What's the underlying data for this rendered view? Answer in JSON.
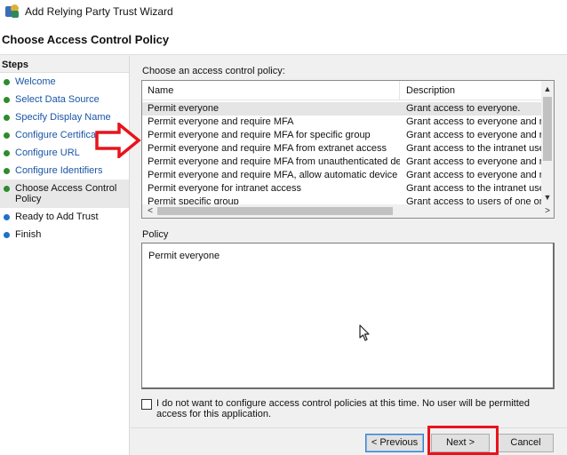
{
  "window": {
    "title": "Add Relying Party Trust Wizard",
    "icon": "relying-party-wizard-icon"
  },
  "header": {
    "page_title": "Choose Access Control Policy"
  },
  "steps": {
    "title": "Steps",
    "items": [
      {
        "label": "Welcome",
        "status": "completed"
      },
      {
        "label": "Select Data Source",
        "status": "completed"
      },
      {
        "label": "Specify Display Name",
        "status": "completed"
      },
      {
        "label": "Configure Certificate",
        "status": "completed"
      },
      {
        "label": "Configure URL",
        "status": "completed"
      },
      {
        "label": "Configure Identifiers",
        "status": "completed"
      },
      {
        "label": "Choose Access Control Policy",
        "status": "current"
      },
      {
        "label": "Ready to Add Trust",
        "status": "pending"
      },
      {
        "label": "Finish",
        "status": "pending"
      }
    ],
    "colors": {
      "completed": "#2e8b2e",
      "pending": "#1f6fd0",
      "link": "#1a55a6"
    }
  },
  "policy_list": {
    "caption": "Choose an access control policy:",
    "columns": [
      "Name",
      "Description"
    ],
    "selected_index": 0,
    "rows": [
      {
        "name": "Permit everyone",
        "description": "Grant access to everyone."
      },
      {
        "name": "Permit everyone and require MFA",
        "description": "Grant access to everyone and requir"
      },
      {
        "name": "Permit everyone and require MFA for specific group",
        "description": "Grant access to everyone and requir"
      },
      {
        "name": "Permit everyone and require MFA from extranet access",
        "description": "Grant access to the intranet users an"
      },
      {
        "name": "Permit everyone and require MFA from unauthenticated devices",
        "description": "Grant access to everyone and requir"
      },
      {
        "name": "Permit everyone and require MFA, allow automatic device registr...",
        "description": "Grant access to everyone and requir"
      },
      {
        "name": "Permit everyone for intranet access",
        "description": "Grant access to the intranet users."
      },
      {
        "name": "Permit specific group",
        "description": "Grant access to users of one or more"
      }
    ],
    "scroll_icons": {
      "up": "▲",
      "down": "▼",
      "left": "<",
      "right": ">"
    }
  },
  "policy_detail": {
    "caption": "Policy",
    "text": "Permit everyone"
  },
  "opt_out": {
    "checked": false,
    "label": "I do not want to configure access control policies at this time. No user will be permitted access for this application."
  },
  "buttons": {
    "previous": "< Previous",
    "next": "Next >",
    "cancel": "Cancel"
  },
  "annotations": {
    "highlight_color": "#e8141c",
    "arrow_target": "policy-list",
    "highlight_target": "next-button"
  }
}
